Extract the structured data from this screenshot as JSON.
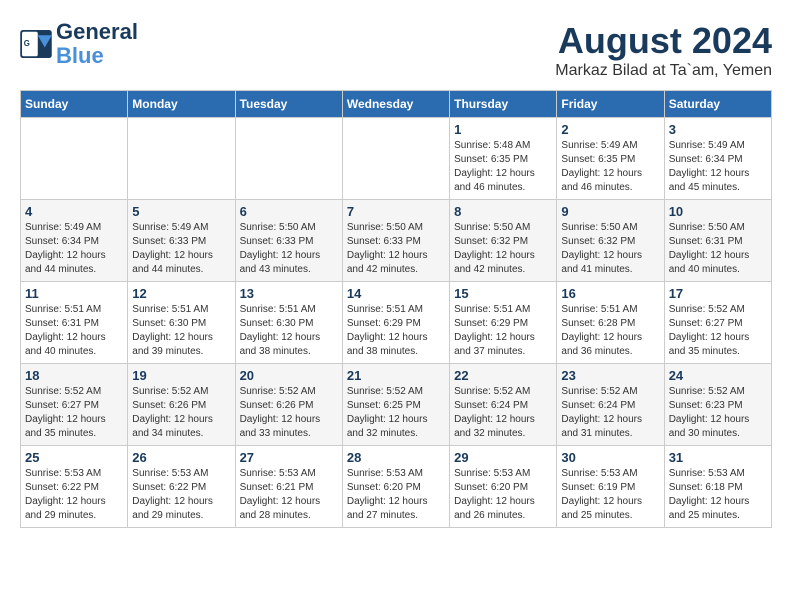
{
  "header": {
    "logo_line1": "General",
    "logo_line2": "Blue",
    "main_title": "August 2024",
    "subtitle": "Markaz Bilad at Ta`am, Yemen"
  },
  "calendar": {
    "weekdays": [
      "Sunday",
      "Monday",
      "Tuesday",
      "Wednesday",
      "Thursday",
      "Friday",
      "Saturday"
    ],
    "weeks": [
      [
        {
          "day": "",
          "info": ""
        },
        {
          "day": "",
          "info": ""
        },
        {
          "day": "",
          "info": ""
        },
        {
          "day": "",
          "info": ""
        },
        {
          "day": "1",
          "info": "Sunrise: 5:48 AM\nSunset: 6:35 PM\nDaylight: 12 hours\nand 46 minutes."
        },
        {
          "day": "2",
          "info": "Sunrise: 5:49 AM\nSunset: 6:35 PM\nDaylight: 12 hours\nand 46 minutes."
        },
        {
          "day": "3",
          "info": "Sunrise: 5:49 AM\nSunset: 6:34 PM\nDaylight: 12 hours\nand 45 minutes."
        }
      ],
      [
        {
          "day": "4",
          "info": "Sunrise: 5:49 AM\nSunset: 6:34 PM\nDaylight: 12 hours\nand 44 minutes."
        },
        {
          "day": "5",
          "info": "Sunrise: 5:49 AM\nSunset: 6:33 PM\nDaylight: 12 hours\nand 44 minutes."
        },
        {
          "day": "6",
          "info": "Sunrise: 5:50 AM\nSunset: 6:33 PM\nDaylight: 12 hours\nand 43 minutes."
        },
        {
          "day": "7",
          "info": "Sunrise: 5:50 AM\nSunset: 6:33 PM\nDaylight: 12 hours\nand 42 minutes."
        },
        {
          "day": "8",
          "info": "Sunrise: 5:50 AM\nSunset: 6:32 PM\nDaylight: 12 hours\nand 42 minutes."
        },
        {
          "day": "9",
          "info": "Sunrise: 5:50 AM\nSunset: 6:32 PM\nDaylight: 12 hours\nand 41 minutes."
        },
        {
          "day": "10",
          "info": "Sunrise: 5:50 AM\nSunset: 6:31 PM\nDaylight: 12 hours\nand 40 minutes."
        }
      ],
      [
        {
          "day": "11",
          "info": "Sunrise: 5:51 AM\nSunset: 6:31 PM\nDaylight: 12 hours\nand 40 minutes."
        },
        {
          "day": "12",
          "info": "Sunrise: 5:51 AM\nSunset: 6:30 PM\nDaylight: 12 hours\nand 39 minutes."
        },
        {
          "day": "13",
          "info": "Sunrise: 5:51 AM\nSunset: 6:30 PM\nDaylight: 12 hours\nand 38 minutes."
        },
        {
          "day": "14",
          "info": "Sunrise: 5:51 AM\nSunset: 6:29 PM\nDaylight: 12 hours\nand 38 minutes."
        },
        {
          "day": "15",
          "info": "Sunrise: 5:51 AM\nSunset: 6:29 PM\nDaylight: 12 hours\nand 37 minutes."
        },
        {
          "day": "16",
          "info": "Sunrise: 5:51 AM\nSunset: 6:28 PM\nDaylight: 12 hours\nand 36 minutes."
        },
        {
          "day": "17",
          "info": "Sunrise: 5:52 AM\nSunset: 6:27 PM\nDaylight: 12 hours\nand 35 minutes."
        }
      ],
      [
        {
          "day": "18",
          "info": "Sunrise: 5:52 AM\nSunset: 6:27 PM\nDaylight: 12 hours\nand 35 minutes."
        },
        {
          "day": "19",
          "info": "Sunrise: 5:52 AM\nSunset: 6:26 PM\nDaylight: 12 hours\nand 34 minutes."
        },
        {
          "day": "20",
          "info": "Sunrise: 5:52 AM\nSunset: 6:26 PM\nDaylight: 12 hours\nand 33 minutes."
        },
        {
          "day": "21",
          "info": "Sunrise: 5:52 AM\nSunset: 6:25 PM\nDaylight: 12 hours\nand 32 minutes."
        },
        {
          "day": "22",
          "info": "Sunrise: 5:52 AM\nSunset: 6:24 PM\nDaylight: 12 hours\nand 32 minutes."
        },
        {
          "day": "23",
          "info": "Sunrise: 5:52 AM\nSunset: 6:24 PM\nDaylight: 12 hours\nand 31 minutes."
        },
        {
          "day": "24",
          "info": "Sunrise: 5:52 AM\nSunset: 6:23 PM\nDaylight: 12 hours\nand 30 minutes."
        }
      ],
      [
        {
          "day": "25",
          "info": "Sunrise: 5:53 AM\nSunset: 6:22 PM\nDaylight: 12 hours\nand 29 minutes."
        },
        {
          "day": "26",
          "info": "Sunrise: 5:53 AM\nSunset: 6:22 PM\nDaylight: 12 hours\nand 29 minutes."
        },
        {
          "day": "27",
          "info": "Sunrise: 5:53 AM\nSunset: 6:21 PM\nDaylight: 12 hours\nand 28 minutes."
        },
        {
          "day": "28",
          "info": "Sunrise: 5:53 AM\nSunset: 6:20 PM\nDaylight: 12 hours\nand 27 minutes."
        },
        {
          "day": "29",
          "info": "Sunrise: 5:53 AM\nSunset: 6:20 PM\nDaylight: 12 hours\nand 26 minutes."
        },
        {
          "day": "30",
          "info": "Sunrise: 5:53 AM\nSunset: 6:19 PM\nDaylight: 12 hours\nand 25 minutes."
        },
        {
          "day": "31",
          "info": "Sunrise: 5:53 AM\nSunset: 6:18 PM\nDaylight: 12 hours\nand 25 minutes."
        }
      ]
    ]
  }
}
